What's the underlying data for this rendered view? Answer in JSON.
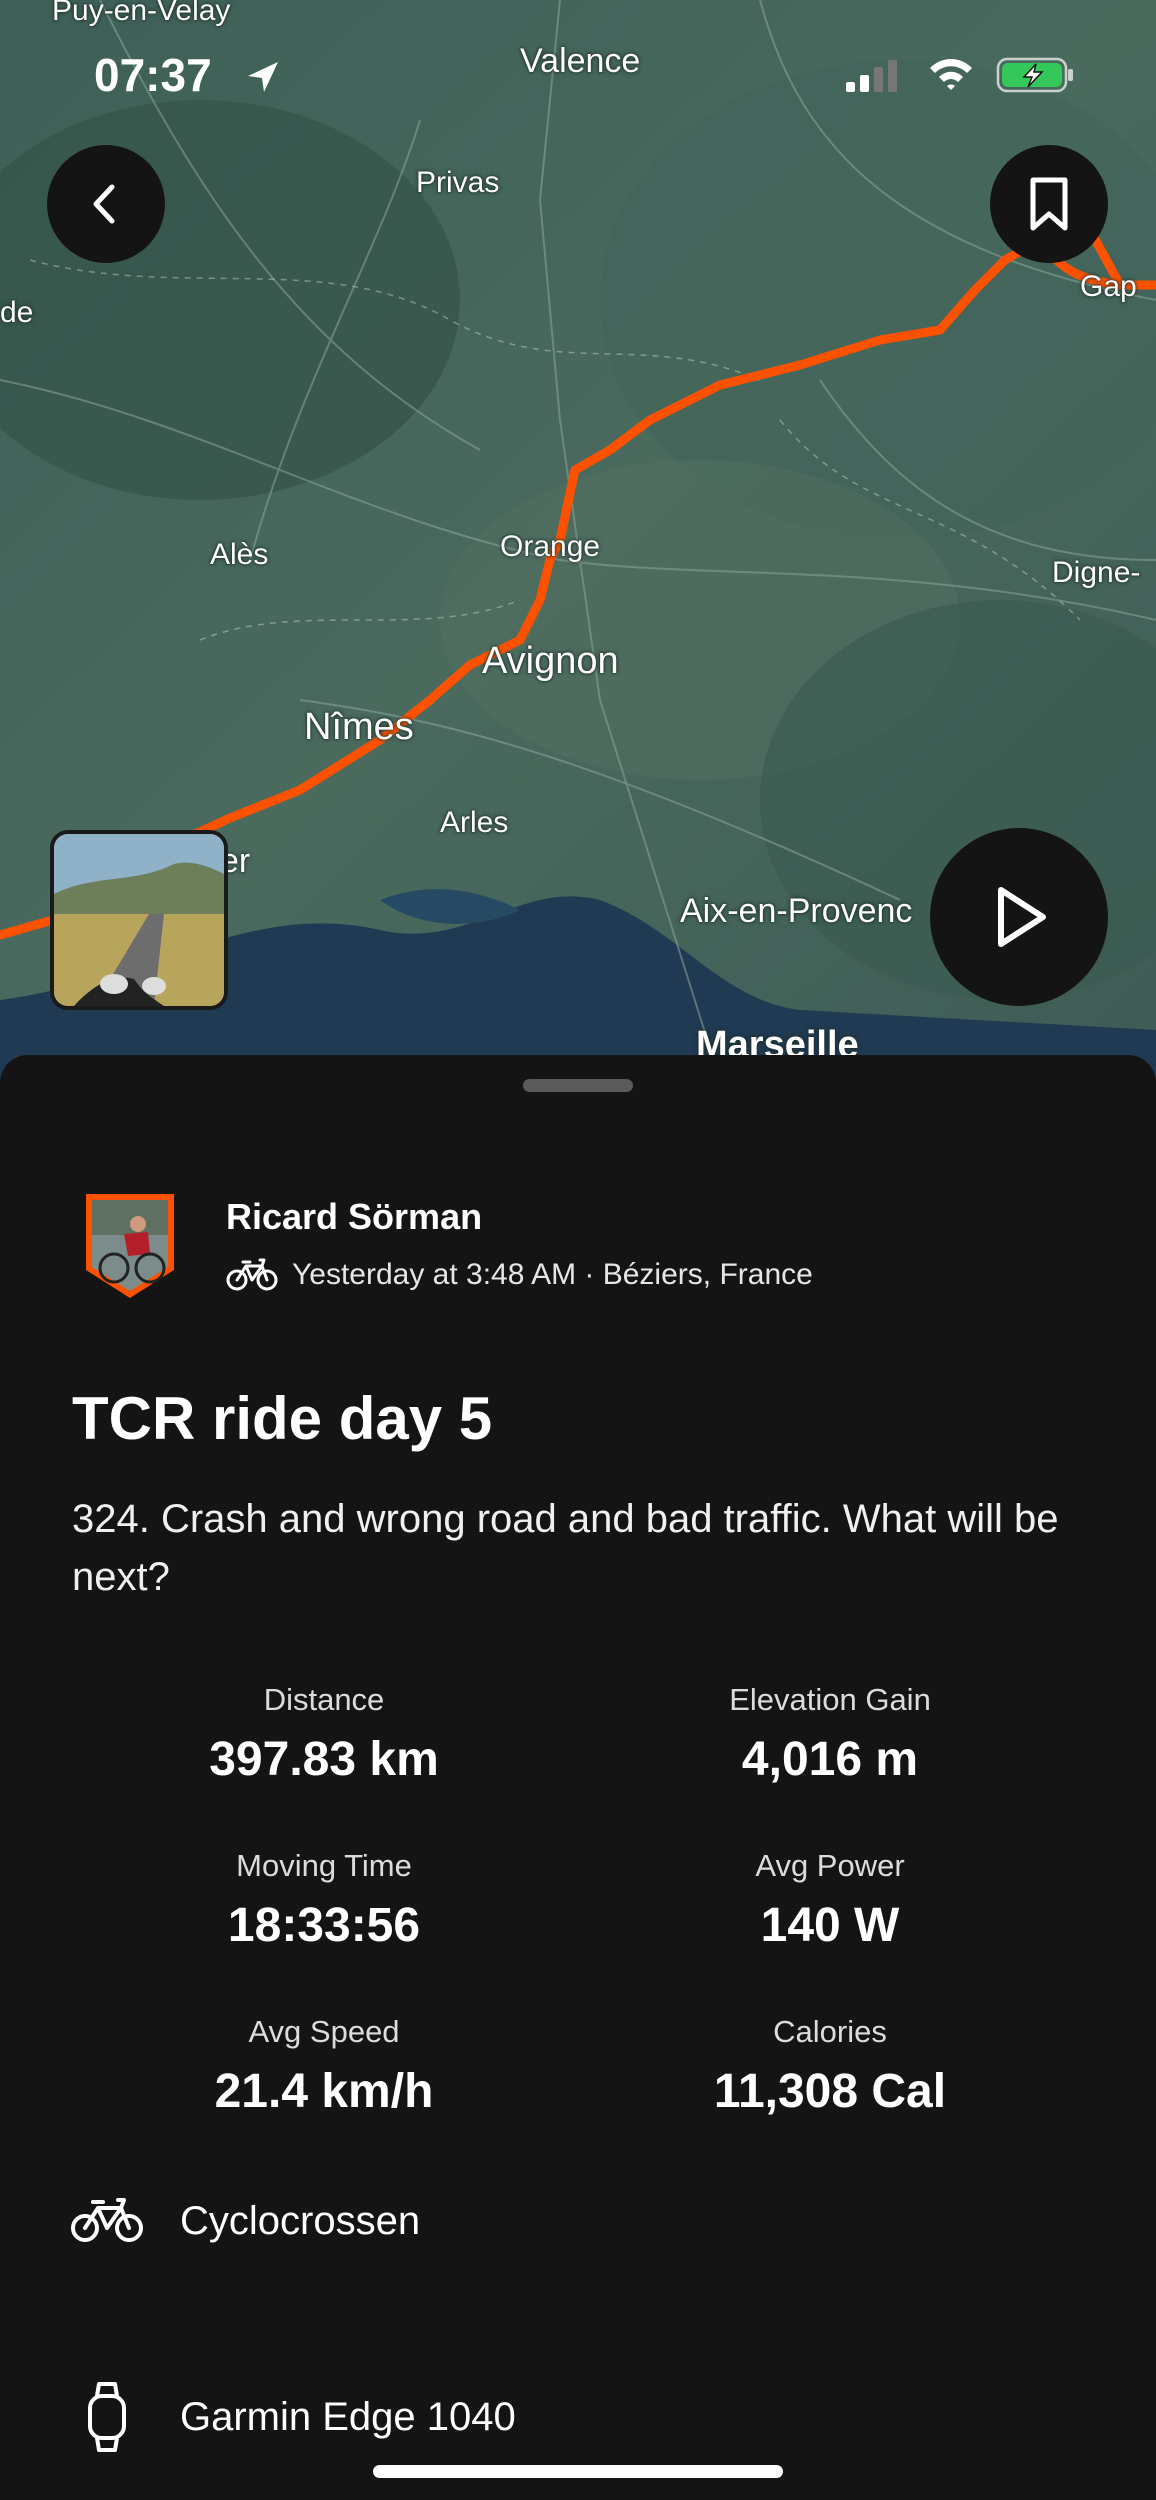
{
  "status_bar": {
    "time": "07:37"
  },
  "map": {
    "labels": [
      "Puy-en-Velay",
      "Valence",
      "Privas",
      "de",
      "Gap",
      "Alès",
      "Orange",
      "Digne-",
      "Avignon",
      "Nîmes",
      "Arles",
      "er",
      "Aix-en-Provenc",
      "Marseille"
    ]
  },
  "activity": {
    "athlete": "Ricard Sörman",
    "meta": "Yesterday at 3:48 AM · Béziers, France",
    "title": "TCR ride day 5",
    "description": "324. Crash and wrong road and bad traffic. What will be next?"
  },
  "stats": [
    {
      "label": "Distance",
      "value": "397.83 km"
    },
    {
      "label": "Elevation Gain",
      "value": "4,016 m"
    },
    {
      "label": "Moving Time",
      "value": "18:33:56"
    },
    {
      "label": "Avg Power",
      "value": "140 W"
    },
    {
      "label": "Avg Speed",
      "value": "21.4 km/h"
    },
    {
      "label": "Calories",
      "value": "11,308 Cal"
    }
  ],
  "gear": {
    "bike": "Cyclocrossen",
    "device": "Garmin Edge 1040"
  },
  "colors": {
    "route": "#fc5200",
    "background": "#141414",
    "battery": "#34c759"
  }
}
